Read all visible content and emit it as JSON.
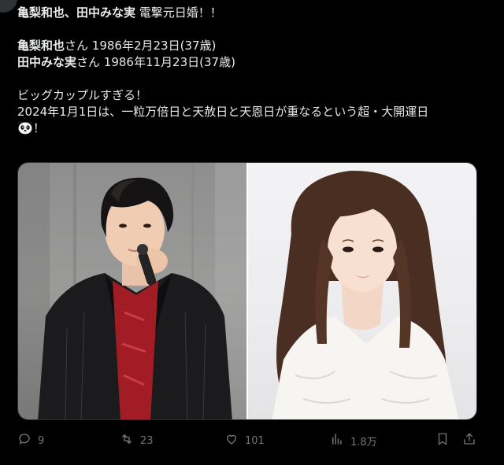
{
  "tweet": {
    "headline_names": "亀梨和也、田中みな実",
    "headline_rest": " 電撃元日婚！！",
    "person1_name": "亀梨和也",
    "person1_rest": "さん 1986年2月23日(37歳)",
    "person2_name": "田中みな実",
    "person2_rest": "さん 1986年11月23日(37歳)",
    "line_big_couple": "ビッグカップルすぎる！",
    "line_lucky_day": "2024年1月1日は、一粒万倍日と天赦日と天恩日が重なるという超・大開運日",
    "line_end": "！"
  },
  "media": {
    "left_photo": "man-with-microphone-photo",
    "right_photo": "woman-portrait-photo"
  },
  "actions": {
    "reply_count": "9",
    "retweet_count": "23",
    "like_count": "101",
    "views_count": "1.8万"
  },
  "colors": {
    "background": "#000000",
    "text": "#e7e9ea",
    "secondary": "#71767b"
  },
  "icons": [
    "reply-icon",
    "retweet-icon",
    "like-icon",
    "views-icon",
    "bookmark-icon",
    "share-icon",
    "panda-emoji-icon"
  ]
}
